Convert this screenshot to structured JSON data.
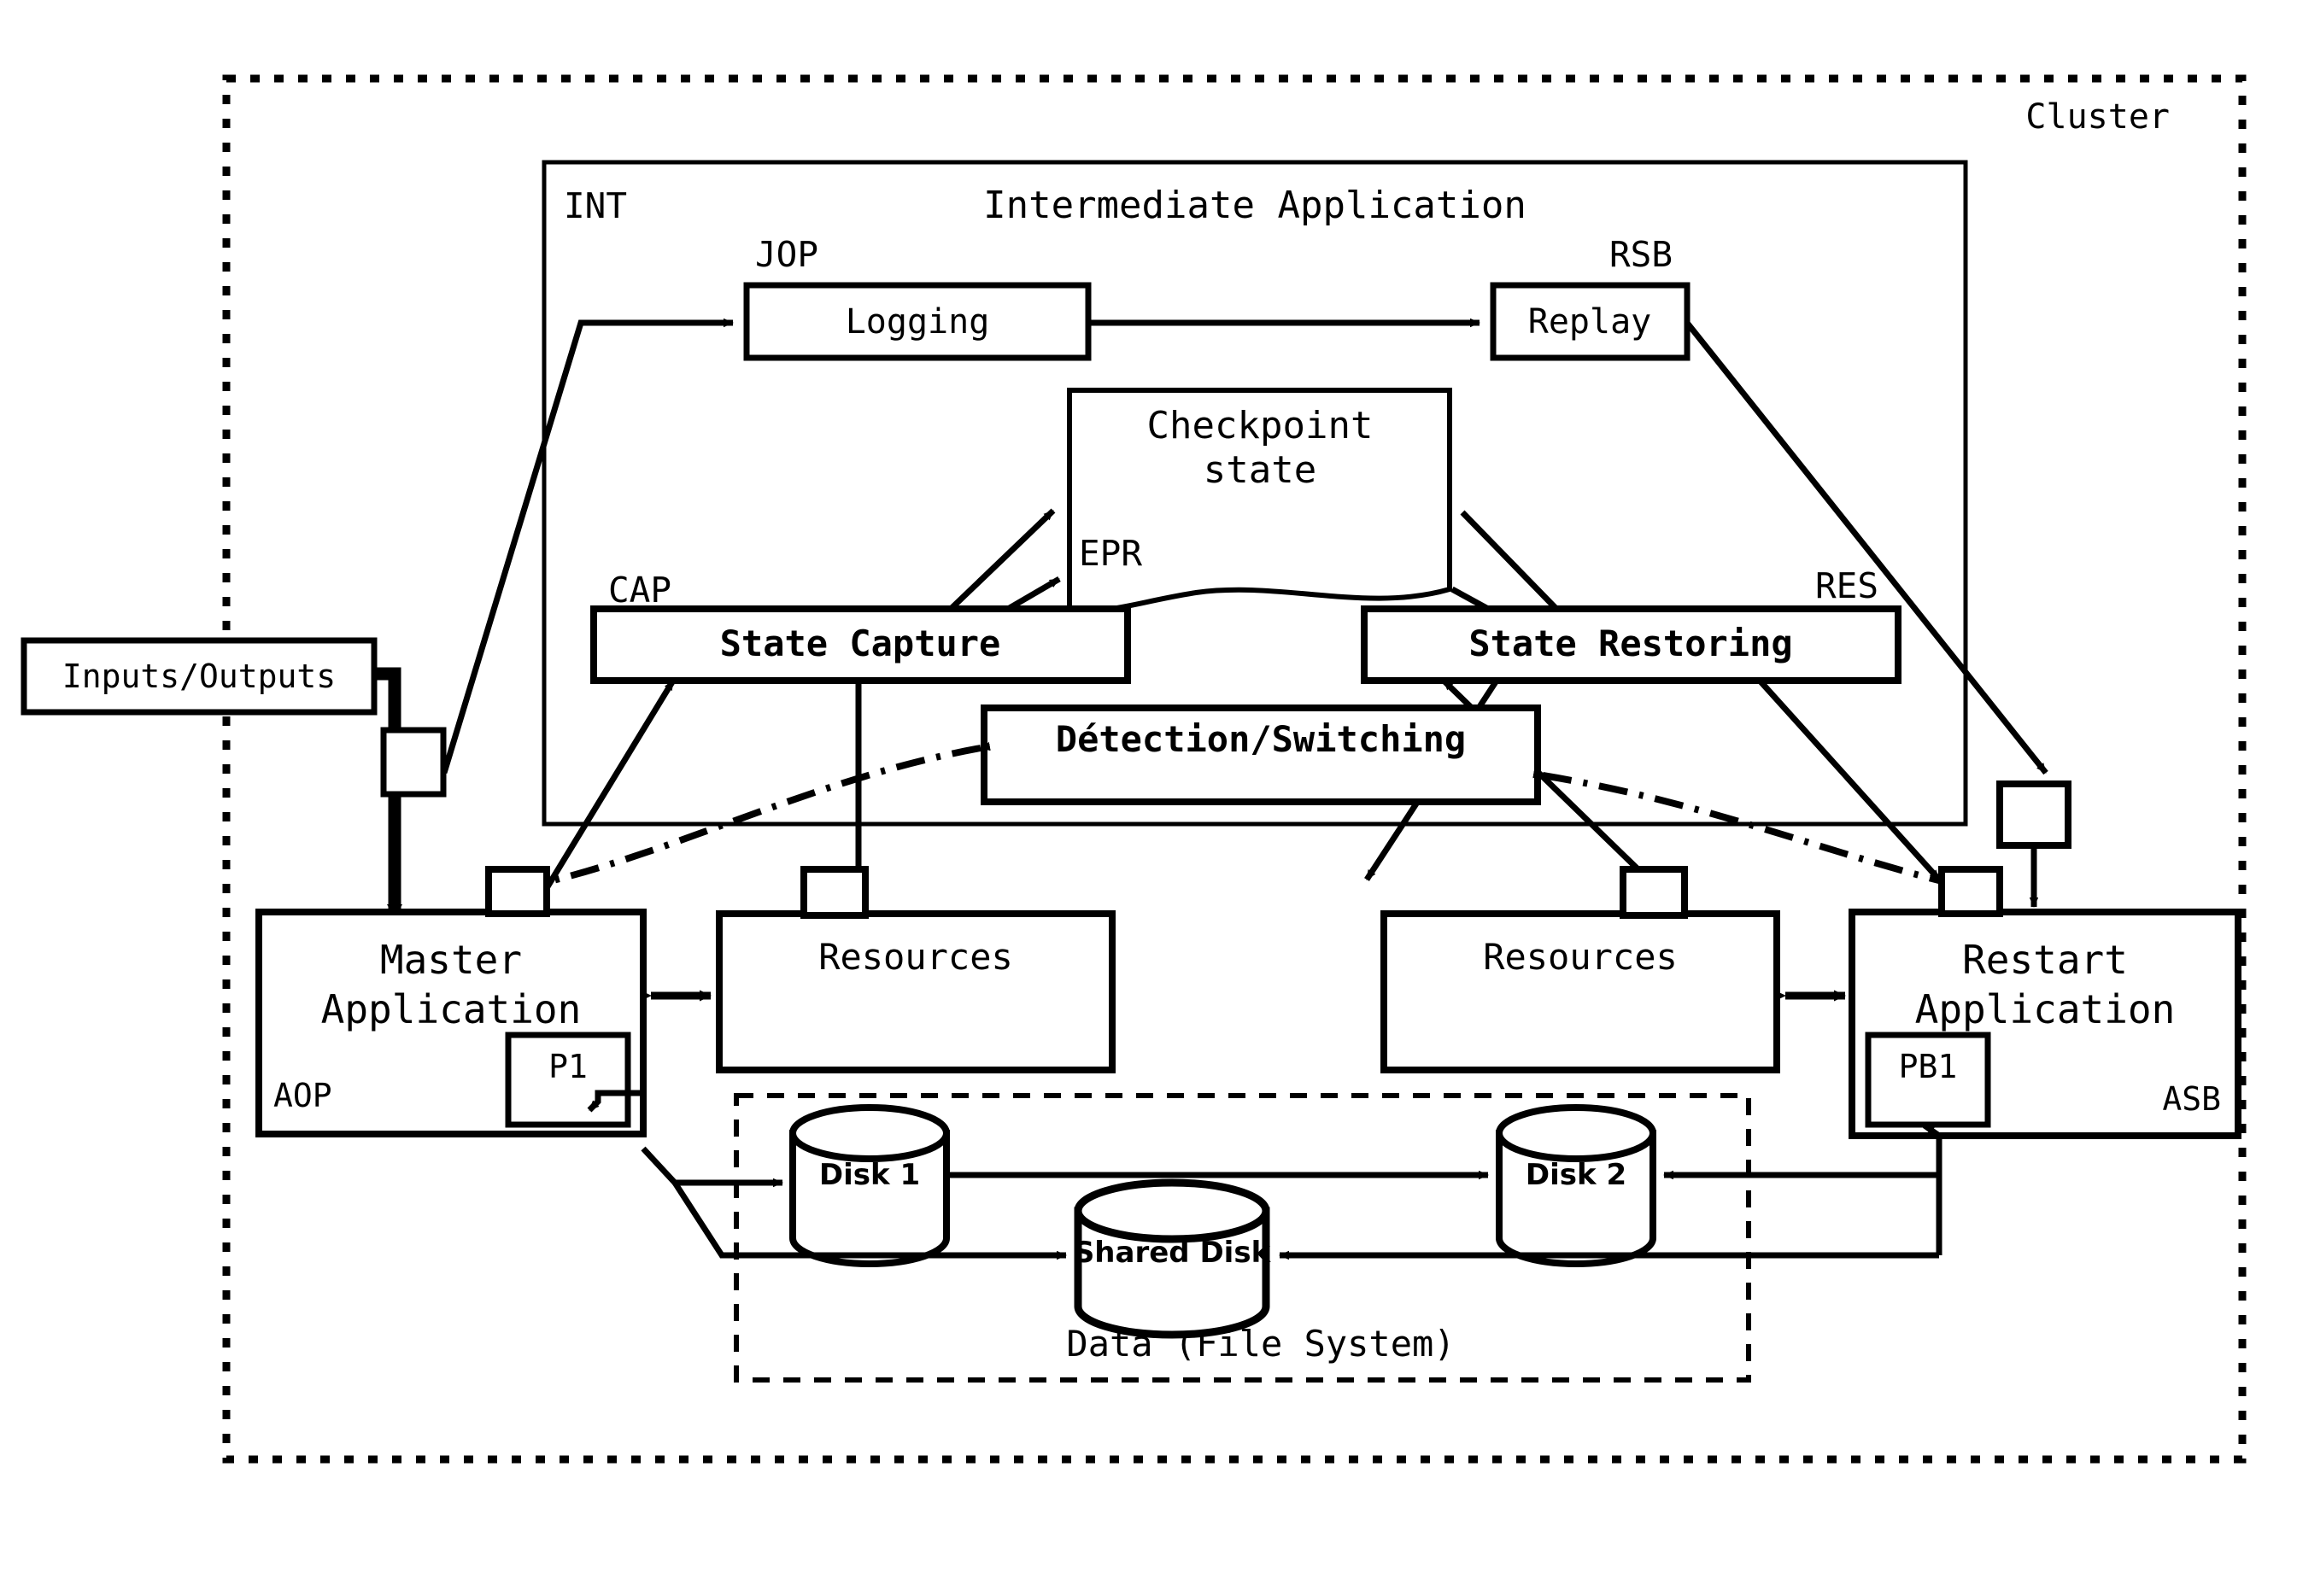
{
  "diagram": {
    "title_cluster": "Cluster",
    "outer": {
      "label": "Cluster"
    },
    "intermediate": {
      "tag": "INT",
      "title": "Intermediate Application",
      "logging": {
        "tag": "JOP",
        "label": "Logging"
      },
      "replay": {
        "tag": "RSB",
        "label": "Replay"
      },
      "checkpoint": {
        "label_line1": "Checkpoint",
        "label_line2": "state",
        "tag": "EPR"
      },
      "state_capture": {
        "tag": "CAP",
        "label": "State Capture"
      },
      "state_restoring": {
        "tag": "RES",
        "label": "State Restoring"
      },
      "detection": {
        "label": "Détection/Switching"
      }
    },
    "io": {
      "label": "Inputs/Outputs"
    },
    "master": {
      "line1": "Master",
      "line2": "Application",
      "tag": "AOP",
      "process": "P1"
    },
    "restart": {
      "line1": "Restart",
      "line2": "Application",
      "tag": "ASB",
      "process": "PB1"
    },
    "resources_left": {
      "label": "Resources"
    },
    "resources_right": {
      "label": "Resources"
    },
    "data": {
      "caption": "Data (File System)",
      "disk1": "Disk 1",
      "disk2": "Disk 2",
      "shared": "Shared Disk"
    },
    "colors": {
      "stroke": "#000000",
      "fill": "#ffffff",
      "background": "#ffffff"
    }
  }
}
